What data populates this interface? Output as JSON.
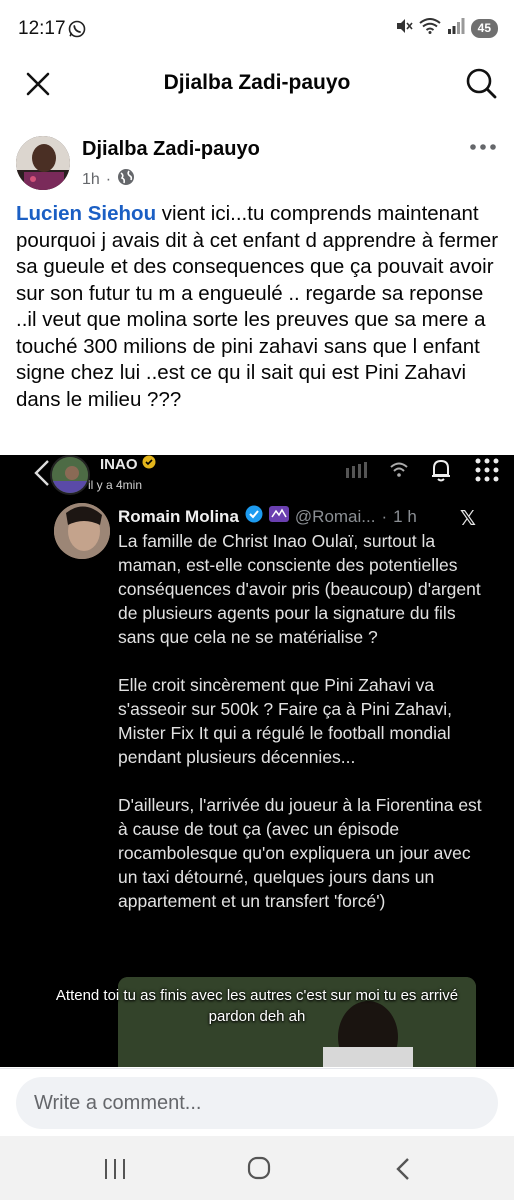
{
  "status_bar": {
    "time": "12:17",
    "battery": "45"
  },
  "header": {
    "title": "Djialba Zadi-pauyo"
  },
  "post": {
    "author": "Djialba Zadi-pauyo",
    "time": "1h",
    "mention": "Lucien Siehou",
    "text": " vient ici...tu comprends maintenant pourquoi j avais dit à cet enfant d apprendre à fermer sa gueule et des consequences que ça pouvait avoir sur son futur tu m a engueulé .. regarde sa reponse ..il veut que molina sorte les preuves que sa mere a touché 300 milions de pini zahavi sans que l enfant signe chez lui ..est ce qu il sait qui est Pini Zahavi dans le milieu ???"
  },
  "embed": {
    "ig_user": "INAO",
    "ig_time": "il y a 4min",
    "tweet": {
      "name": "Romain Molina",
      "handle": "@Romai...",
      "sep": "·",
      "time": "1 h",
      "x_logo": "𝕏",
      "paragraphs": [
        "La famille de Christ Inao Oulaï, surtout la maman, est-elle consciente des potentielles conséquences d'avoir pris (beaucoup) d'argent de plusieurs agents pour la signature du fils sans que cela ne se matérialise ?",
        "Elle croit sincèrement que Pini Zahavi va s'asseoir sur 500k ? Faire ça à Pini Zahavi, Mister Fix It qui a régulé le football mondial pendant plusieurs décennies...",
        "D'ailleurs, l'arrivée du joueur à la Fiorentina est à cause de tout ça (avec un épisode rocambolesque qu'on expliquera un jour avec un taxi détourné, quelques jours dans un appartement et un transfert 'forcé')"
      ]
    },
    "caption": "Attend toi tu as finis avec les autres c'est sur moi tu es arrivé pardon deh ah"
  },
  "comment": {
    "placeholder": "Write a comment..."
  },
  "colors": {
    "mention": "#1b5fc4",
    "verified": "#1d9bf0",
    "gold_badge": "#e3b51b"
  }
}
